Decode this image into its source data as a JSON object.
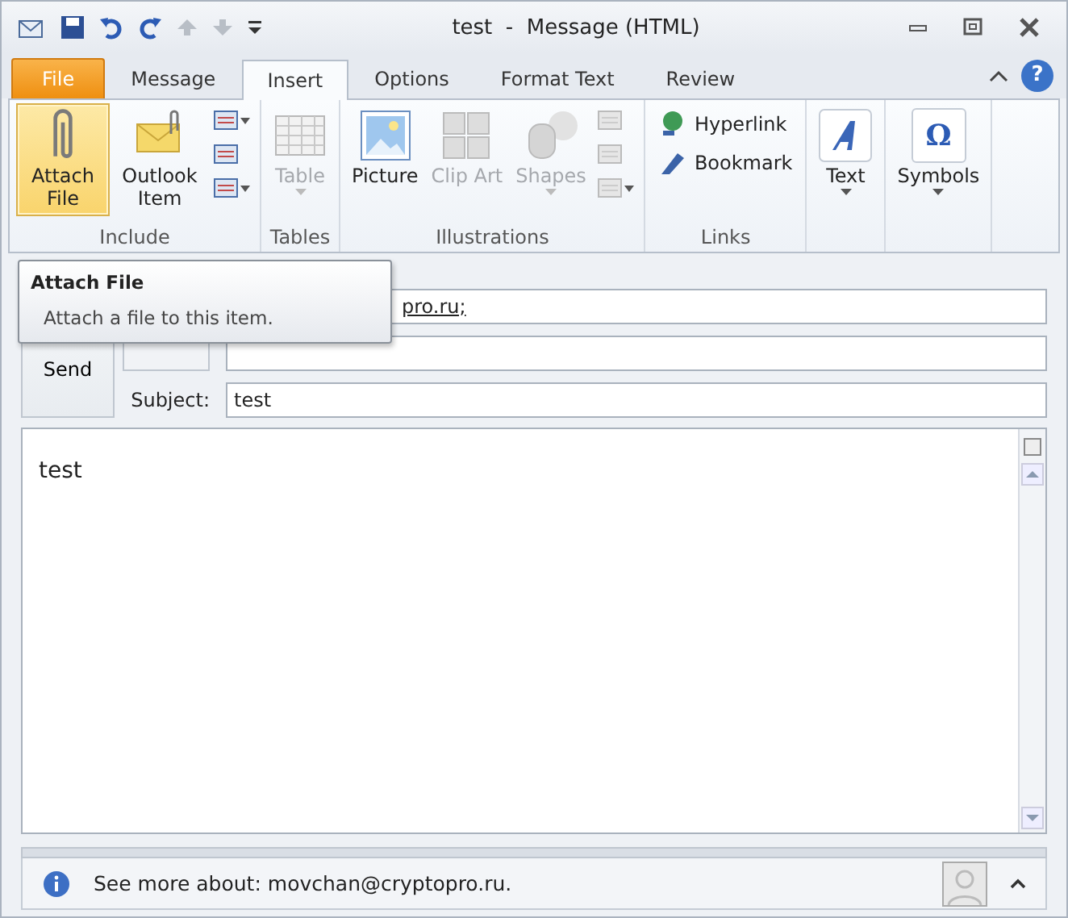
{
  "window": {
    "title": "test  -  Message (HTML)"
  },
  "tabs": [
    {
      "label": "File",
      "kind": "file",
      "selected": false
    },
    {
      "label": "Message",
      "kind": "tab",
      "selected": false
    },
    {
      "label": "Insert",
      "kind": "tab",
      "selected": true
    },
    {
      "label": "Options",
      "kind": "tab",
      "selected": false
    },
    {
      "label": "Format Text",
      "kind": "tab",
      "selected": false
    },
    {
      "label": "Review",
      "kind": "tab",
      "selected": false
    }
  ],
  "help": "?",
  "ribbon": {
    "groups": [
      {
        "label": "Include",
        "buttons": [
          {
            "kind": "large",
            "label": "Attach File",
            "selected": true,
            "disabled": false,
            "dropdown": false
          },
          {
            "kind": "large",
            "label": "Outlook Item",
            "selected": false,
            "disabled": false,
            "dropdown": false
          },
          {
            "kind": "small",
            "dropdown": true
          },
          {
            "kind": "small",
            "dropdown": false
          },
          {
            "kind": "small",
            "dropdown": true
          }
        ]
      },
      {
        "label": "Tables",
        "buttons": [
          {
            "kind": "large",
            "label": "Table",
            "selected": false,
            "disabled": true,
            "dropdown": true
          }
        ]
      },
      {
        "label": "Illustrations",
        "buttons": [
          {
            "kind": "large",
            "label": "Picture",
            "selected": false,
            "disabled": false,
            "dropdown": false
          },
          {
            "kind": "large",
            "label": "Clip Art",
            "selected": false,
            "disabled": true,
            "dropdown": false
          },
          {
            "kind": "large",
            "label": "Shapes",
            "selected": false,
            "disabled": true,
            "dropdown": true
          },
          {
            "kind": "small",
            "dropdown": false
          },
          {
            "kind": "small",
            "dropdown": false
          },
          {
            "kind": "small",
            "dropdown": true
          }
        ]
      },
      {
        "label": "Links",
        "buttons": [
          {
            "kind": "wide",
            "label": "Hyperlink"
          },
          {
            "kind": "wide",
            "label": "Bookmark"
          }
        ]
      },
      {
        "buttons": [
          {
            "kind": "large",
            "label": "Text",
            "selected": false,
            "disabled": false,
            "dropdown": true
          }
        ]
      },
      {
        "buttons": [
          {
            "kind": "large",
            "label": "Symbols",
            "glyph": "Ω",
            "selected": false,
            "disabled": false,
            "dropdown": true
          }
        ]
      }
    ]
  },
  "tooltip": {
    "title": "Attach File",
    "text": "Attach a file to this item."
  },
  "compose": {
    "send": "Send",
    "to_value": "pro.ru;",
    "subject_label": "Subject:",
    "subject_value": "test",
    "body": "test"
  },
  "status_bar": {
    "text": "See more about: movchan@cryptopro.ru."
  }
}
